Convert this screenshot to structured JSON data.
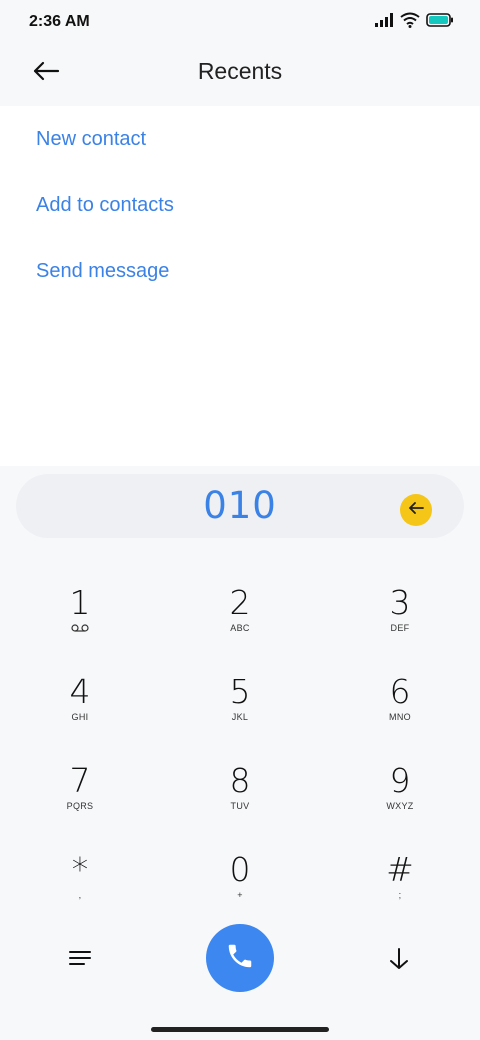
{
  "status_bar": {
    "time": "2:36 AM",
    "icons": [
      "signal-icon",
      "wifi-icon",
      "battery-icon"
    ],
    "battery_color": "#14c8c0"
  },
  "header": {
    "title": "Recents",
    "back_icon": "arrow-left-icon"
  },
  "actions": [
    {
      "label": "New contact"
    },
    {
      "label": "Add to contacts"
    },
    {
      "label": "Send message"
    }
  ],
  "dialer": {
    "number": "010",
    "backspace_icon": "backspace-icon",
    "accent_color": "#3b82e6",
    "backspace_color": "#f5c518",
    "keys": [
      {
        "digit": "1",
        "sub": ""
      },
      {
        "digit": "2",
        "sub": "ABC"
      },
      {
        "digit": "3",
        "sub": "DEF"
      },
      {
        "digit": "4",
        "sub": "GHI"
      },
      {
        "digit": "5",
        "sub": "JKL"
      },
      {
        "digit": "6",
        "sub": "MNO"
      },
      {
        "digit": "7",
        "sub": "PQRS"
      },
      {
        "digit": "8",
        "sub": "TUV"
      },
      {
        "digit": "9",
        "sub": "WXYZ"
      },
      {
        "digit": "*",
        "sub": ","
      },
      {
        "digit": "0",
        "sub": "+"
      },
      {
        "digit": "#",
        "sub": ";"
      }
    ],
    "key1_sub_icon": "voicemail-icon"
  },
  "bottom_bar": {
    "menu_icon": "menu-icon",
    "call_icon": "phone-icon",
    "call_color": "#3d87f0",
    "hide_icon": "arrow-down-icon"
  }
}
